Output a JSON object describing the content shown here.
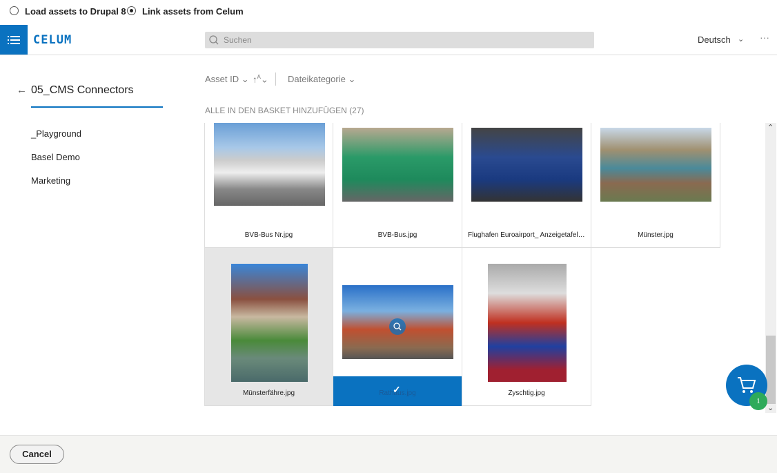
{
  "mode_options": [
    {
      "label": "Load assets to Drupal 8",
      "selected": false
    },
    {
      "label": "Link assets from Celum",
      "selected": true
    }
  ],
  "header": {
    "logo": "CELUM",
    "search_placeholder": "Suchen",
    "language": "Deutsch"
  },
  "sidebar": {
    "back_title": "05_CMS Connectors",
    "items": [
      {
        "label": "_Playground"
      },
      {
        "label": "Basel Demo"
      },
      {
        "label": "Marketing"
      }
    ]
  },
  "toolbar": {
    "sort_field": "Asset ID",
    "filter": "Dateikategorie",
    "add_all": "ALLE IN DEN BASKET HINZUFÜGEN (27)"
  },
  "assets": [
    {
      "name": "BVB-Bus Nr.jpg"
    },
    {
      "name": "BVB-Bus.jpg"
    },
    {
      "name": "Flughafen Euroairport_ Anzeigetafel.jpg"
    },
    {
      "name": "Münster.jpg"
    },
    {
      "name": "Münsterfähre.jpg"
    },
    {
      "name": "Rathaus.jpg",
      "selected": true
    },
    {
      "name": "Zyschtig.jpg"
    }
  ],
  "basket": {
    "count": "1"
  },
  "footer": {
    "cancel": "Cancel"
  },
  "colors": {
    "accent": "#0a72c0",
    "badge": "#2eaa5a"
  }
}
